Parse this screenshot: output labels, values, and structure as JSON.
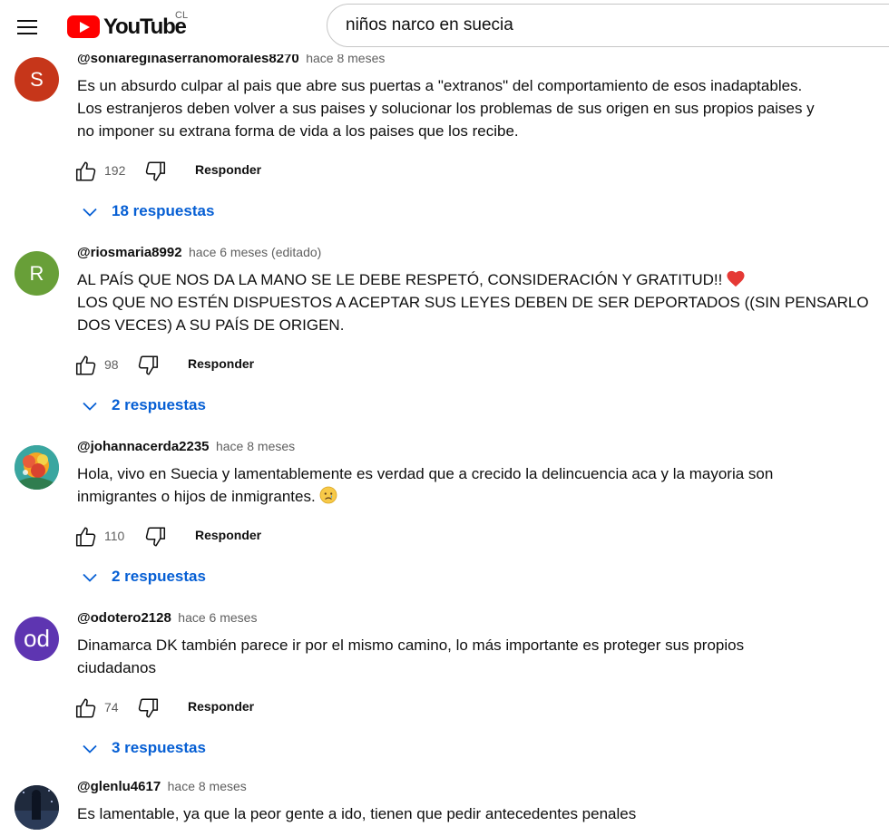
{
  "header": {
    "logo_text": "YouTube",
    "country_code": "CL",
    "search_value": "niños narco en suecia"
  },
  "labels": {
    "reply": "Responder"
  },
  "comments": [
    {
      "author": "@soniareginaserranomorales8270",
      "time": "hace 8 meses",
      "avatar_letter": "S",
      "avatar_color": "#c6361a",
      "lines": [
        "Es un absurdo culpar al pais que abre sus puertas a \"extranos\" del comportamiento de esos inadaptables.",
        "Los estranjeros deben volver a sus paises y solucionar los problemas de sus origen en sus propios paises y",
        "no imponer su extrana forma de vida a los paises que los recibe."
      ],
      "likes": "192",
      "replies": "18 respuestas"
    },
    {
      "author": "@riosmaria8992",
      "time": "hace 6 meses (editado)",
      "avatar_letter": "R",
      "avatar_color": "#689f38",
      "lines": [
        "AL PAÍS QUE NOS DA LA MANO SE LE DEBE RESPETÓ, CONSIDERACIÓN Y GRATITUD!!",
        "LOS QUE NO ESTÉN DISPUESTOS A ACEPTAR SUS LEYES DEBEN DE SER DEPORTADOS ((SIN PENSARLO",
        "DOS VECES) A SU PAÍS DE ORIGEN."
      ],
      "likes": "98",
      "replies": "2 respuestas"
    },
    {
      "author": "@johannacerda2235",
      "time": "hace 8 meses",
      "avatar_letter": "",
      "avatar_color": "#e67e22",
      "lines": [
        "Hola, vivo en Suecia y lamentablemente es verdad que a crecido la delincuencia aca y la mayoria son",
        "inmigrantes o hijos de inmigrantes."
      ],
      "likes": "110",
      "replies": "2 respuestas"
    },
    {
      "author": "@odotero2128",
      "time": "hace 6 meses",
      "avatar_letter": "od",
      "avatar_color": "#5e35b1",
      "lines": [
        "Dinamarca DK también parece ir por el mismo camino, lo más importante es proteger sus propios",
        "ciudadanos"
      ],
      "likes": "74",
      "replies": "3 respuestas"
    },
    {
      "author": "@glenlu4617",
      "time": "hace 8 meses",
      "avatar_letter": "",
      "avatar_color": "#2c3e50",
      "lines": [
        "Es lamentable, ya que la peor gente a ido, tienen que pedir antecedentes penales"
      ]
    }
  ]
}
